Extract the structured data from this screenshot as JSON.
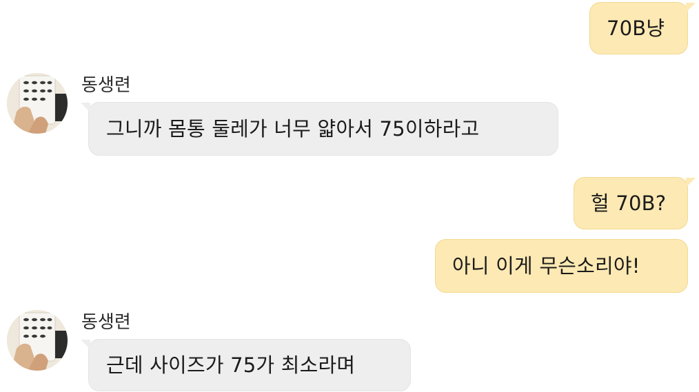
{
  "messages": [
    {
      "direction": "outgoing",
      "text": "70B냥"
    },
    {
      "direction": "incoming",
      "sender": "동생련",
      "text": "그니까 몸통 둘레가 너무 얇아서 75이하라고"
    },
    {
      "direction": "outgoing",
      "text": "헐 70B?"
    },
    {
      "direction": "outgoing",
      "text": "아니 이게 무슨소리야!"
    },
    {
      "direction": "incoming",
      "sender": "동생련",
      "text": "근데 사이즈가 75가 최소라며"
    }
  ],
  "colors": {
    "outgoing_bubble": "#fde9b3",
    "incoming_bubble": "#eeeeee",
    "background": "#ffffff"
  },
  "icons": {
    "avatar": "profile-photo"
  }
}
